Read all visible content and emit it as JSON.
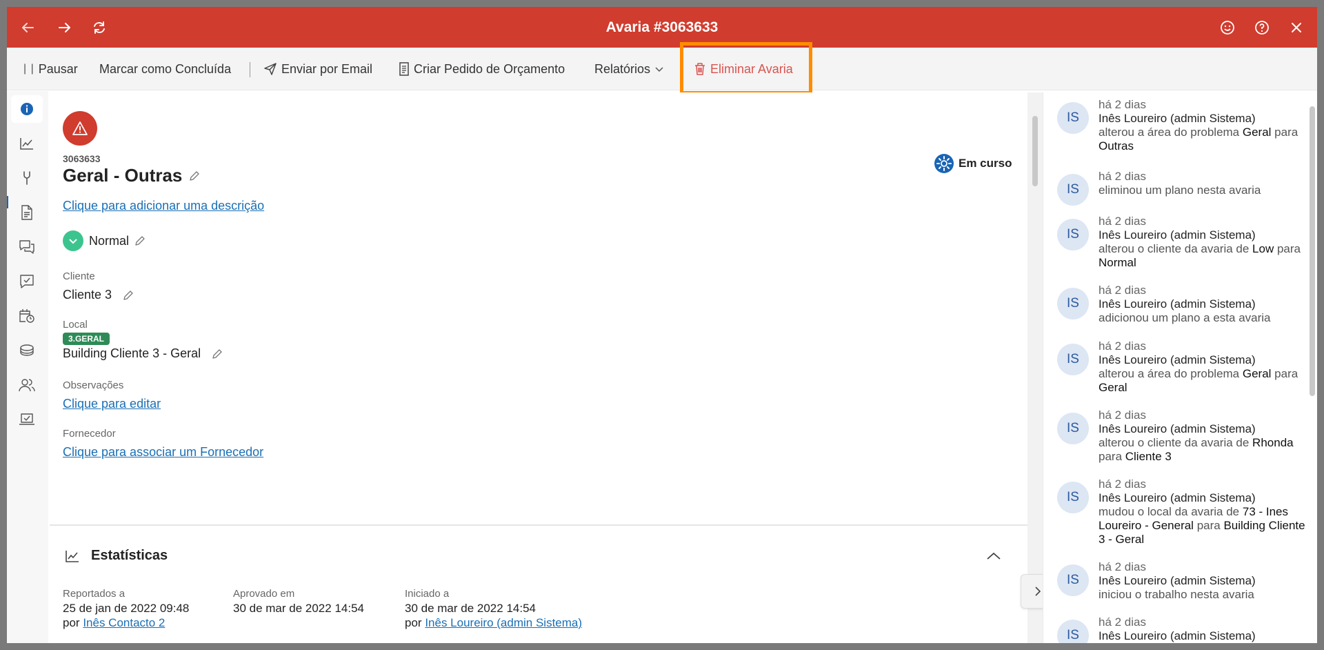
{
  "window": {
    "title": "Avaria #3063633"
  },
  "toolbar": {
    "pause_label": "Pausar",
    "complete_label": "Marcar como Concluída",
    "email_label": "Enviar por Email",
    "quote_label": "Criar Pedido de Orçamento",
    "reports_label": "Relatórios",
    "delete_label": "Eliminar Avaria"
  },
  "issue": {
    "number": "3063633",
    "title": "Geral - Outras",
    "status": "Em curso",
    "add_description": "Clique para adicionar uma descrição",
    "priority": "Normal",
    "client_label": "Cliente",
    "client_value": "Cliente 3",
    "local_label": "Local",
    "local_badge": "3.GERAL",
    "local_value": "Building Cliente 3 - Geral",
    "notes_label": "Observações",
    "notes_link": "Clique para editar",
    "supplier_label": "Fornecedor",
    "supplier_link": "Clique para associar um Fornecedor"
  },
  "stats": {
    "title": "Estatísticas",
    "reported_label": "Reportados a",
    "reported_date": "25 de jan de 2022 09:48",
    "reported_by_prefix": "por",
    "reported_by": "Inês Contacto 2",
    "approved_label": "Aprovado em",
    "approved_date": "30 de mar de 2022 14:54",
    "started_label": "Iniciado a",
    "started_date": "30 de mar de 2022 14:54",
    "started_by_prefix": "por",
    "started_by": "Inês Loureiro (admin Sistema)"
  },
  "feed": [
    {
      "initials": "IS",
      "when": "há 2 dias",
      "who": "Inês Loureiro (admin Sistema)",
      "parts": [
        "alterou a área do problema ",
        "Geral",
        " para ",
        "Outras"
      ]
    },
    {
      "initials": "IS",
      "when": "há 2 dias",
      "who": "",
      "parts": [
        "eliminou um plano nesta avaria"
      ]
    },
    {
      "initials": "IS",
      "when": "há 2 dias",
      "who": "Inês Loureiro (admin Sistema)",
      "parts": [
        "alterou o cliente da avaria de ",
        "Low",
        " para ",
        "Normal"
      ]
    },
    {
      "initials": "IS",
      "when": "há 2 dias",
      "who": "Inês Loureiro (admin Sistema)",
      "parts": [
        "adicionou um plano a esta avaria"
      ]
    },
    {
      "initials": "IS",
      "when": "há 2 dias",
      "who": "Inês Loureiro (admin Sistema)",
      "parts": [
        "alterou a área do problema ",
        "Geral",
        " para ",
        "Geral"
      ]
    },
    {
      "initials": "IS",
      "when": "há 2 dias",
      "who": "Inês Loureiro (admin Sistema)",
      "parts": [
        "alterou o cliente da avaria de ",
        "Rhonda",
        " para ",
        "Cliente 3"
      ]
    },
    {
      "initials": "IS",
      "when": "há 2 dias",
      "who": "Inês Loureiro (admin Sistema)",
      "parts": [
        "mudou o local da avaria de ",
        "73 - Ines Loureiro - General",
        " para ",
        "Building Cliente 3 - Geral"
      ]
    },
    {
      "initials": "IS",
      "when": "há 2 dias",
      "who": "Inês Loureiro (admin Sistema)",
      "parts": [
        "iniciou o trabalho nesta avaria"
      ]
    },
    {
      "initials": "IS",
      "when": "há 2 dias",
      "who": "Inês Loureiro (admin Sistema)",
      "parts": [
        ""
      ]
    }
  ],
  "colors": {
    "brand": "#d03c2e",
    "link": "#1a6fb5",
    "danger": "#d9534f",
    "highlight": "#ff8c00",
    "priority": "#3cc48f",
    "badge": "#2e8b57"
  }
}
